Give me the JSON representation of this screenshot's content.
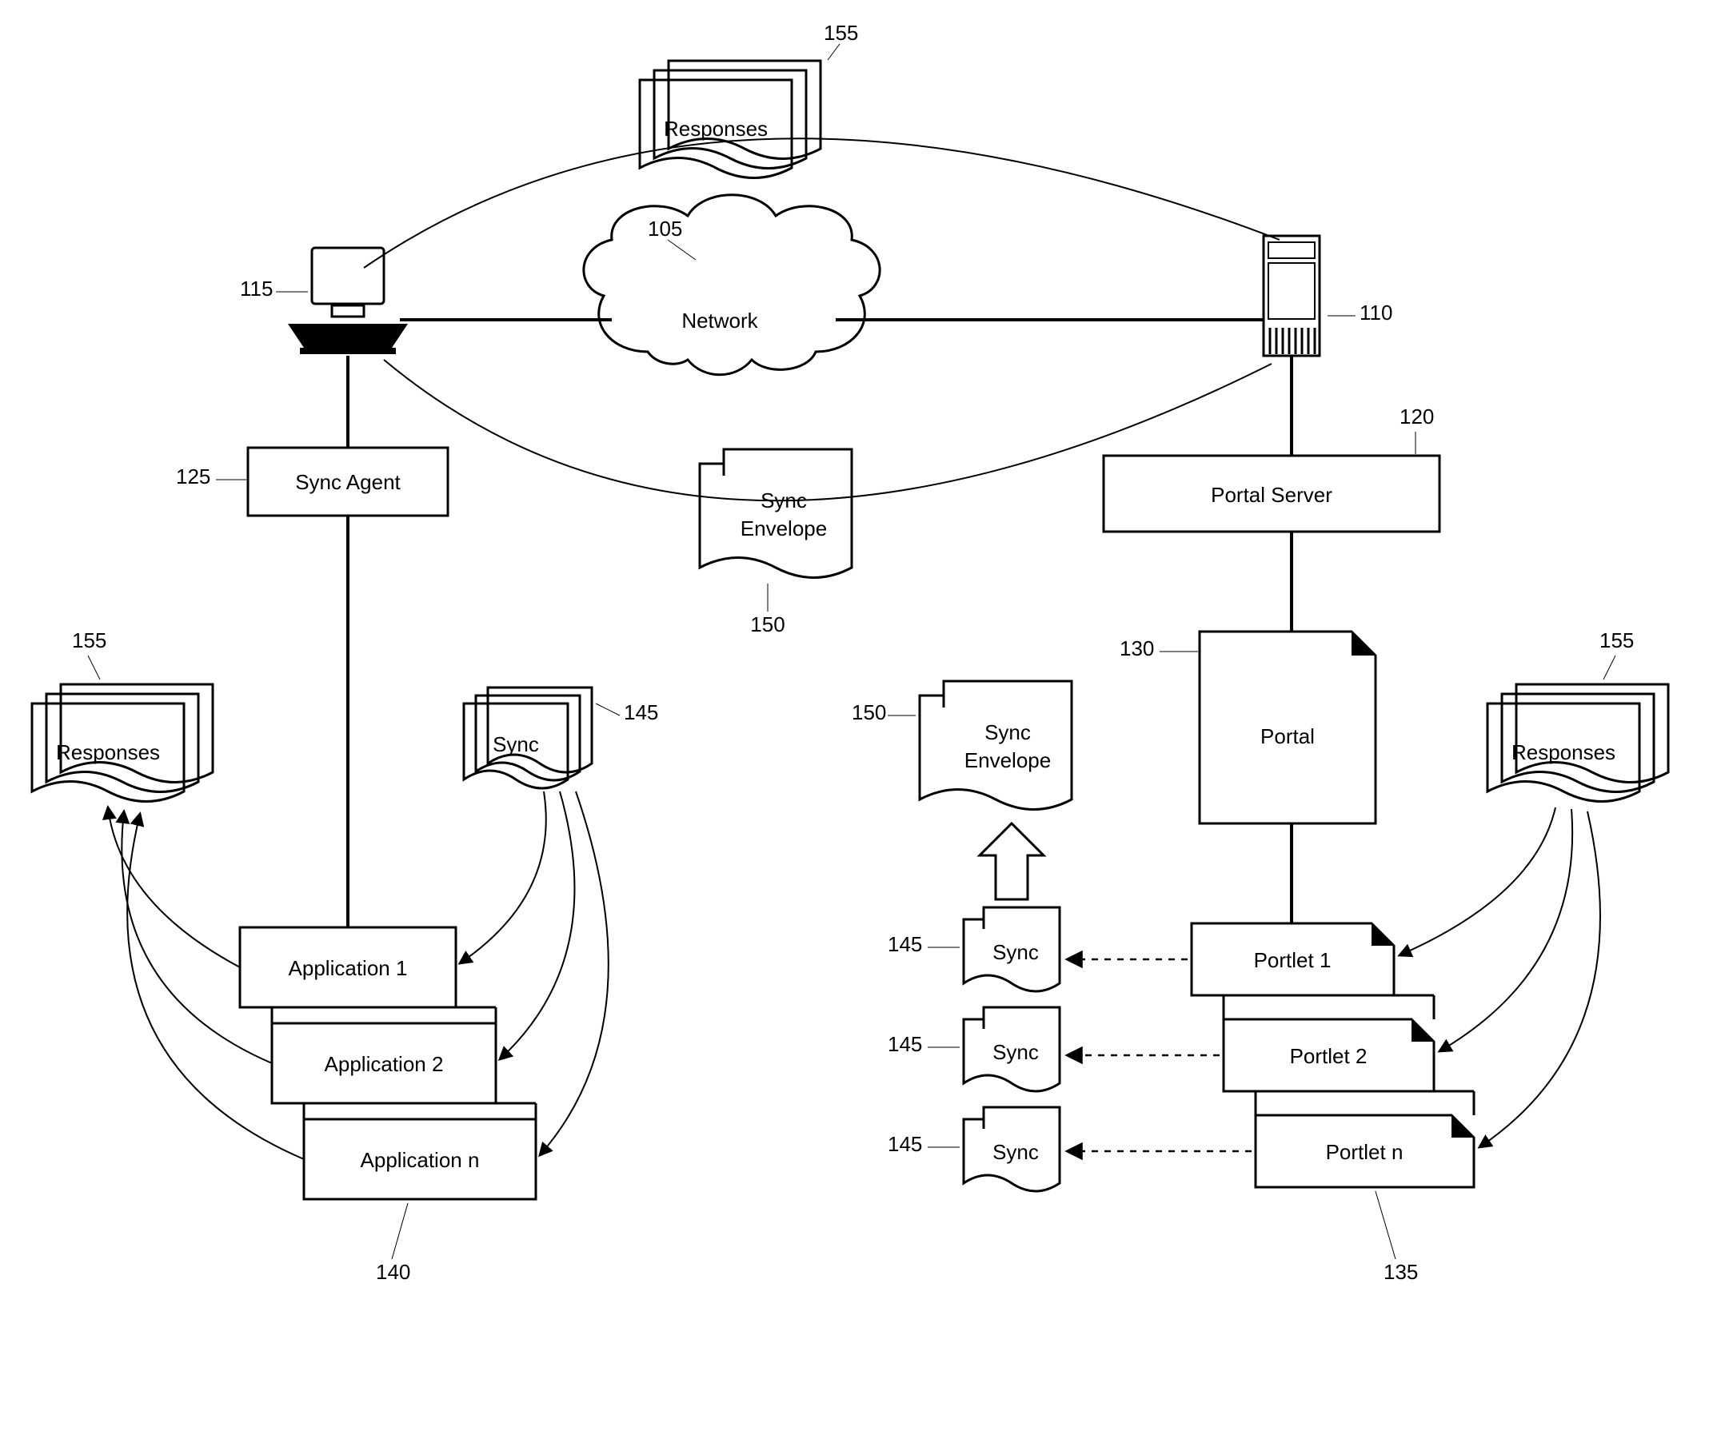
{
  "refs": {
    "network": "105",
    "server": "110",
    "client": "115",
    "portal_server": "120",
    "sync_agent": "125",
    "portal": "130",
    "portlets": "135",
    "applications": "140",
    "sync1": "145",
    "sync2a": "145",
    "sync2b": "145",
    "sync2c": "145",
    "sync_envelope_top": "150",
    "sync_envelope_mid": "150",
    "responses_top": "155",
    "responses_left": "155",
    "responses_right": "155"
  },
  "labels": {
    "network": "Network",
    "responses": "Responses",
    "sync": "Sync",
    "sync_envelope_l1": "Sync",
    "sync_envelope_l2": "Envelope",
    "sync_agent": "Sync Agent",
    "portal_server": "Portal Server",
    "portal": "Portal",
    "app1": "Application 1",
    "app2": "Application 2",
    "app_n": "Application n",
    "portlet1": "Portlet 1",
    "portlet2": "Portlet 2",
    "portlet_n": "Portlet n"
  },
  "chart_data": {
    "type": "diagram",
    "nodes": [
      {
        "id": 105,
        "label": "Network",
        "kind": "cloud"
      },
      {
        "id": 110,
        "label": "Server",
        "kind": "server"
      },
      {
        "id": 115,
        "label": "Client computer",
        "kind": "computer"
      },
      {
        "id": 120,
        "label": "Portal Server",
        "kind": "box"
      },
      {
        "id": 125,
        "label": "Sync Agent",
        "kind": "box"
      },
      {
        "id": 130,
        "label": "Portal",
        "kind": "document"
      },
      {
        "id": 135,
        "label": "Portlets",
        "kind": "document-stack",
        "items": [
          "Portlet 1",
          "Portlet 2",
          "Portlet n"
        ]
      },
      {
        "id": 140,
        "label": "Applications",
        "kind": "box-stack",
        "items": [
          "Application 1",
          "Application 2",
          "Application n"
        ]
      },
      {
        "id": 145,
        "label": "Sync",
        "kind": "document",
        "instances": 4
      },
      {
        "id": 150,
        "label": "Sync Envelope",
        "kind": "document",
        "instances": 2
      },
      {
        "id": 155,
        "label": "Responses",
        "kind": "document-stack",
        "instances": 3
      }
    ],
    "edges": [
      {
        "from": 115,
        "to": 105,
        "style": "solid"
      },
      {
        "from": 105,
        "to": 110,
        "style": "solid"
      },
      {
        "from": 115,
        "to": 125,
        "style": "solid"
      },
      {
        "from": 125,
        "to": 140,
        "style": "solid"
      },
      {
        "from": 110,
        "to": 120,
        "style": "solid"
      },
      {
        "from": 120,
        "to": 130,
        "style": "solid"
      },
      {
        "from": 130,
        "to": 135,
        "style": "solid"
      },
      {
        "from": 115,
        "to": 110,
        "via": 155,
        "style": "curve-top",
        "label": "Responses"
      },
      {
        "from": 115,
        "to": 110,
        "via": 150,
        "style": "curve-bottom",
        "label": "Sync Envelope"
      },
      {
        "from": 145,
        "to": 140,
        "style": "curve",
        "direction": "to-each",
        "label": "Sync"
      },
      {
        "from": 140,
        "to": 155,
        "style": "curve",
        "direction": "from-each",
        "label": "Responses (left)"
      },
      {
        "from": 135,
        "to": 145,
        "style": "dashed",
        "direction": "each",
        "label": "Sync"
      },
      {
        "from": 145,
        "to": 150,
        "style": "block-arrow",
        "label": "aggregate"
      },
      {
        "from": 155,
        "to": 135,
        "style": "curve",
        "direction": "to-each",
        "label": "Responses (right)"
      }
    ]
  }
}
